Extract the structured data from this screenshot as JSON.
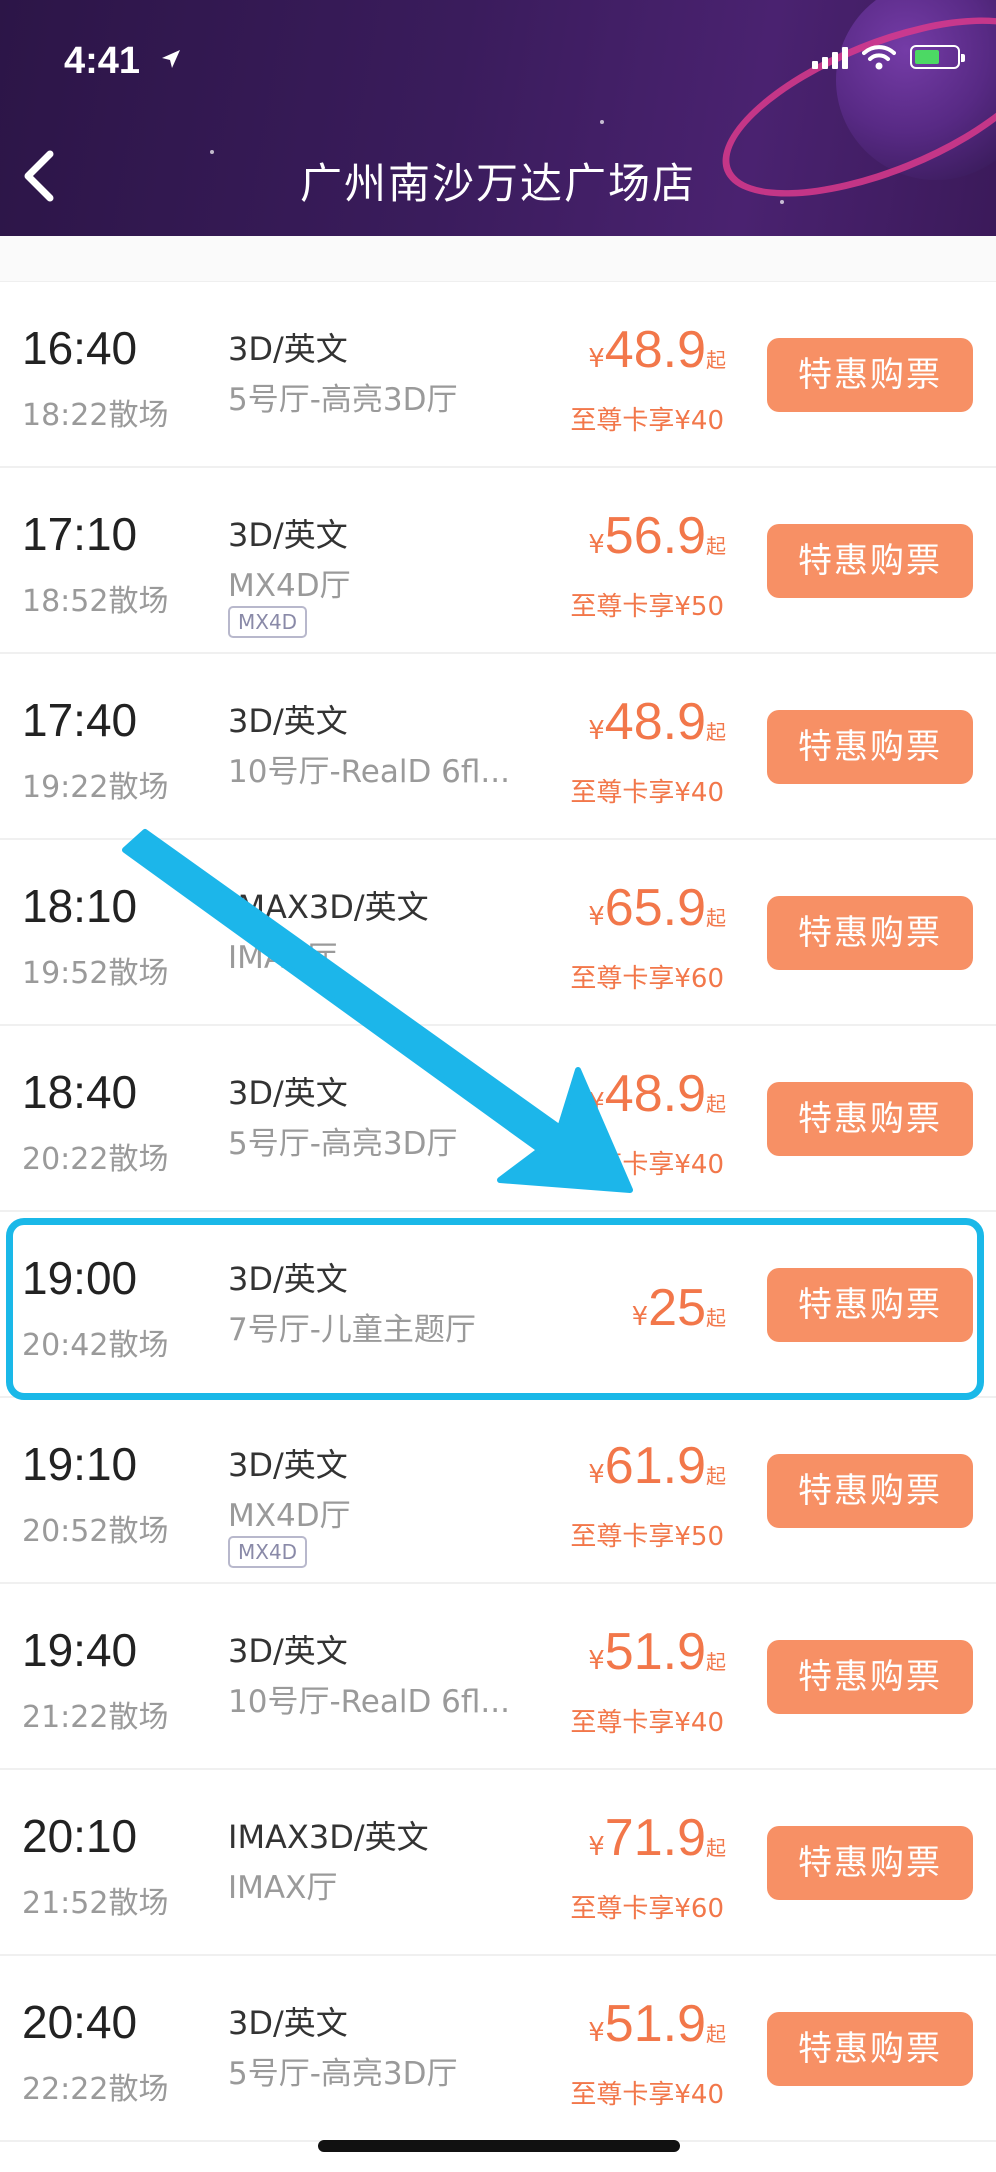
{
  "status_bar": {
    "time": "4:41"
  },
  "header": {
    "title": "广州南沙万达广场店"
  },
  "colors": {
    "header_bg": "#3a1c5c",
    "accent": "#f2774a",
    "button_bg": "#f79065",
    "highlight": "#1ab8e8"
  },
  "sessions": [
    {
      "start": "16:40",
      "end": "18:22散场",
      "lang": "3D/英文",
      "hall": "5号厅-高亮3D厅",
      "yen": "¥",
      "price": "48.9",
      "qi": "起",
      "member": "至尊卡享¥40",
      "button": "特惠购票"
    },
    {
      "start": "17:10",
      "end": "18:52散场",
      "lang": "3D/英文",
      "hall": "MX4D厅",
      "tag": "MX4D",
      "yen": "¥",
      "price": "56.9",
      "qi": "起",
      "member": "至尊卡享¥50",
      "button": "特惠购票"
    },
    {
      "start": "17:40",
      "end": "19:22散场",
      "lang": "3D/英文",
      "hall": "10号厅-RealD 6fl...",
      "yen": "¥",
      "price": "48.9",
      "qi": "起",
      "member": "至尊卡享¥40",
      "button": "特惠购票"
    },
    {
      "start": "18:10",
      "end": "19:52散场",
      "lang": "IMAX3D/英文",
      "hall": "IMAX厅",
      "yen": "¥",
      "price": "65.9",
      "qi": "起",
      "member": "至尊卡享¥60",
      "button": "特惠购票"
    },
    {
      "start": "18:40",
      "end": "20:22散场",
      "lang": "3D/英文",
      "hall": "5号厅-高亮3D厅",
      "yen": "¥",
      "price": "48.9",
      "qi": "起",
      "member": "至尊卡享¥40",
      "button": "特惠购票"
    },
    {
      "start": "19:00",
      "end": "20:42散场",
      "lang": "3D/英文",
      "hall": "7号厅-儿童主题厅",
      "yen": "¥",
      "price": "25",
      "qi": "起",
      "button": "特惠购票"
    },
    {
      "start": "19:10",
      "end": "20:52散场",
      "lang": "3D/英文",
      "hall": "MX4D厅",
      "tag": "MX4D",
      "yen": "¥",
      "price": "61.9",
      "qi": "起",
      "member": "至尊卡享¥50",
      "button": "特惠购票"
    },
    {
      "start": "19:40",
      "end": "21:22散场",
      "lang": "3D/英文",
      "hall": "10号厅-RealD 6fl...",
      "yen": "¥",
      "price": "51.9",
      "qi": "起",
      "member": "至尊卡享¥40",
      "button": "特惠购票"
    },
    {
      "start": "20:10",
      "end": "21:52散场",
      "lang": "IMAX3D/英文",
      "hall": "IMAX厅",
      "yen": "¥",
      "price": "71.9",
      "qi": "起",
      "member": "至尊卡享¥60",
      "button": "特惠购票"
    },
    {
      "start": "20:40",
      "end": "22:22散场",
      "lang": "3D/英文",
      "hall": "5号厅-高亮3D厅",
      "yen": "¥",
      "price": "51.9",
      "qi": "起",
      "member": "至尊卡享¥40",
      "button": "特惠购票"
    }
  ]
}
